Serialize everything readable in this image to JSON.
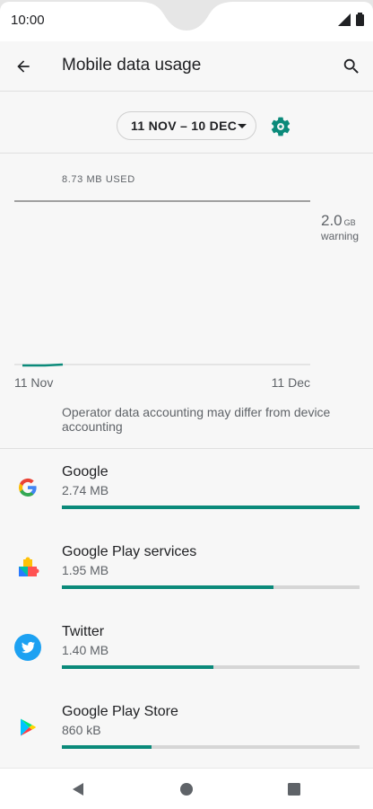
{
  "status_bar": {
    "time": "10:00"
  },
  "app_bar": {
    "title": "Mobile data usage"
  },
  "cycle": {
    "label": "11 NOV – 10 DEC"
  },
  "chart": {
    "used_label": "8.73 MB USED",
    "warning_value": "2.0",
    "warning_unit": "GB",
    "warning_label": "warning",
    "start_label": "11 Nov",
    "end_label": "11 Dec"
  },
  "note": "Operator data accounting may differ from device accounting",
  "apps": [
    {
      "name": "Google",
      "size": "2.74 MB",
      "fraction": 1.0,
      "icon": "google-icon"
    },
    {
      "name": "Google Play services",
      "size": "1.95 MB",
      "fraction": 0.71,
      "icon": "google-play-services-icon"
    },
    {
      "name": "Twitter",
      "size": "1.40 MB",
      "fraction": 0.51,
      "icon": "twitter-icon"
    },
    {
      "name": "Google Play Store",
      "size": "860 kB",
      "fraction": 0.3,
      "icon": "google-play-store-icon"
    }
  ],
  "colors": {
    "accent": "#0b8a7a",
    "track": "#d6d6d6"
  }
}
